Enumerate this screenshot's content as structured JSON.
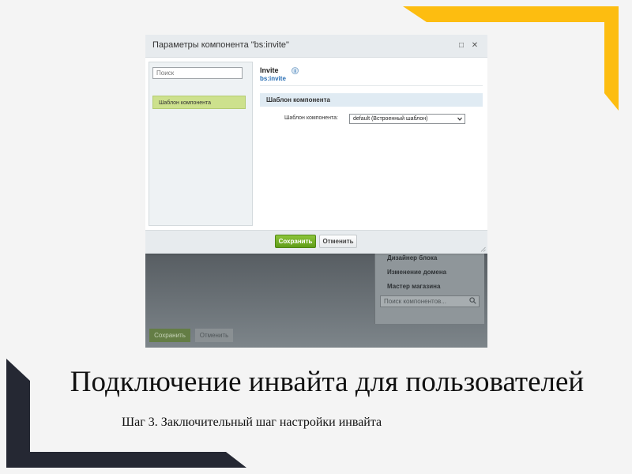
{
  "colors": {
    "accent_yellow": "#FDBD10",
    "frame_dark": "#252833",
    "save_green": "#6ba624",
    "tab_green": "#cde18d"
  },
  "dialog": {
    "title": "Параметры компонента \"bs:invite\"",
    "titlebar_icons": [
      "maximize-icon",
      "close-icon"
    ],
    "maximize_glyph": "□",
    "close_glyph": "✕",
    "search_placeholder": "Поиск",
    "left_tabs": [
      {
        "label": "Шаблон компонента",
        "active": true
      }
    ],
    "component_name": "Invite",
    "component_code": "bs:invite",
    "section_title": "Шаблон компонента",
    "field_label": "Шаблон компонента:",
    "field_value": "default (Встроенный шаблон)",
    "save_label": "Сохранить",
    "cancel_label": "Отменить"
  },
  "background_editor": {
    "items": [
      "Дизайнер блока",
      "Изменение домена",
      "Мастер магазина"
    ],
    "search_placeholder": "Поиск компонентов...",
    "save_label": "Сохранить",
    "cancel_label": "Отменить"
  },
  "slide": {
    "heading": "Подключение инвайта для пользователей",
    "subheading": "Шаг 3. Заключительный шаг настройки инвайта"
  }
}
